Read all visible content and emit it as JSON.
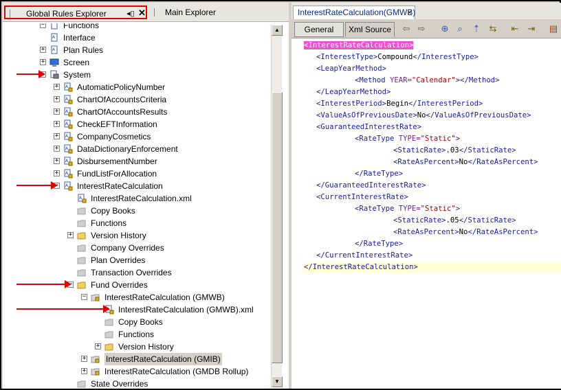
{
  "left_panel": {
    "active_tab": "Global Rules Explorer",
    "inactive_tab": "Main Explorer",
    "tree": [
      {
        "label": "Functions",
        "indent": 0,
        "kind": "folder-doc",
        "expander": "minus"
      },
      {
        "label": "Interface",
        "indent": 0,
        "kind": "doc",
        "expander": "none"
      },
      {
        "label": "Plan Rules",
        "indent": 0,
        "kind": "doc",
        "expander": "plus"
      },
      {
        "label": "Screen",
        "indent": 0,
        "kind": "screen",
        "expander": "plus"
      },
      {
        "label": "System",
        "indent": 0,
        "kind": "system",
        "expander": "minus"
      },
      {
        "label": "AutomaticPolicyNumber",
        "indent": 1,
        "kind": "lockdoc",
        "expander": "plus"
      },
      {
        "label": "ChartOfAccountsCriteria",
        "indent": 1,
        "kind": "lockdoc",
        "expander": "plus"
      },
      {
        "label": "ChartOfAccountsResults",
        "indent": 1,
        "kind": "lockdoc",
        "expander": "plus"
      },
      {
        "label": "CheckEFTInformation",
        "indent": 1,
        "kind": "lockdoc",
        "expander": "plus"
      },
      {
        "label": "CompanyCosmetics",
        "indent": 1,
        "kind": "lockdoc",
        "expander": "plus"
      },
      {
        "label": "DataDictionaryEnforcement",
        "indent": 1,
        "kind": "lockdoc",
        "expander": "plus"
      },
      {
        "label": "DisbursementNumber",
        "indent": 1,
        "kind": "lockdoc",
        "expander": "plus"
      },
      {
        "label": "FundListForAllocation",
        "indent": 1,
        "kind": "lockdoc",
        "expander": "plus"
      },
      {
        "label": "InterestRateCalculation",
        "indent": 1,
        "kind": "lockdoc",
        "expander": "minus"
      },
      {
        "label": "InterestRateCalculation.xml",
        "indent": 2,
        "kind": "lockdoc",
        "expander": "none"
      },
      {
        "label": "Copy Books",
        "indent": 2,
        "kind": "greyfolder",
        "expander": "none"
      },
      {
        "label": "Functions",
        "indent": 2,
        "kind": "greyfolder",
        "expander": "none"
      },
      {
        "label": "Version History",
        "indent": 2,
        "kind": "folder",
        "expander": "plus"
      },
      {
        "label": "Company Overrides",
        "indent": 2,
        "kind": "greyfolder",
        "expander": "none"
      },
      {
        "label": "Plan Overrides",
        "indent": 2,
        "kind": "greyfolder",
        "expander": "none"
      },
      {
        "label": "Transaction Overrides",
        "indent": 2,
        "kind": "greyfolder",
        "expander": "none"
      },
      {
        "label": "Fund Overrides",
        "indent": 2,
        "kind": "folder",
        "expander": "minus"
      },
      {
        "label": "InterestRateCalculation (GMWB)",
        "indent": 3,
        "kind": "lockfolder",
        "expander": "minus"
      },
      {
        "label": "InterestRateCalculation (GMWB).xml",
        "indent": 4,
        "kind": "lockdoc",
        "expander": "none"
      },
      {
        "label": "Copy Books",
        "indent": 4,
        "kind": "greyfolder",
        "expander": "none"
      },
      {
        "label": "Functions",
        "indent": 4,
        "kind": "greyfolder",
        "expander": "none"
      },
      {
        "label": "Version History",
        "indent": 4,
        "kind": "folder",
        "expander": "plus"
      },
      {
        "label": "InterestRateCalculation (GMIB)",
        "indent": 3,
        "kind": "lockfolder",
        "expander": "plus",
        "selected": true
      },
      {
        "label": "InterestRateCalculation (GMDB Rollup)",
        "indent": 3,
        "kind": "lockfolder",
        "expander": "plus"
      },
      {
        "label": "State Overrides",
        "indent": 2,
        "kind": "greyfolder",
        "expander": "none"
      }
    ]
  },
  "right_panel": {
    "document_tab": "InterestRateCalculation(GMWB)",
    "close_glyph": "×",
    "sub_tabs": [
      "General",
      "Xml Source"
    ],
    "active_sub_tab": "Xml Source",
    "xml_lines": [
      {
        "indent": 0,
        "parts": [
          {
            "t": "tag",
            "v": "<InterestRateCalculation>"
          }
        ],
        "highlight": true
      },
      {
        "indent": 1,
        "parts": [
          {
            "t": "tag",
            "v": "<InterestType>"
          },
          {
            "t": "txt",
            "v": "Compound"
          },
          {
            "t": "tag",
            "v": "</InterestType>"
          }
        ]
      },
      {
        "indent": 1,
        "parts": [
          {
            "t": "tag",
            "v": "<LeapYearMethod>"
          }
        ]
      },
      {
        "indent": 2,
        "parts": [
          {
            "t": "tag",
            "v": "<Method "
          },
          {
            "t": "attr",
            "v": "YEAR="
          },
          {
            "t": "val",
            "v": "\"Calendar\""
          },
          {
            "t": "tag",
            "v": "></Method>"
          }
        ]
      },
      {
        "indent": 1,
        "parts": [
          {
            "t": "tag",
            "v": "</LeapYearMethod>"
          }
        ]
      },
      {
        "indent": 1,
        "parts": [
          {
            "t": "tag",
            "v": "<InterestPeriod>"
          },
          {
            "t": "txt",
            "v": "Begin"
          },
          {
            "t": "tag",
            "v": "</InterestPeriod>"
          }
        ]
      },
      {
        "indent": 1,
        "parts": [
          {
            "t": "tag",
            "v": "<ValueAsOfPreviousDate>"
          },
          {
            "t": "txt",
            "v": "No"
          },
          {
            "t": "tag",
            "v": "</ValueAsOfPreviousDate>"
          }
        ]
      },
      {
        "indent": 1,
        "parts": [
          {
            "t": "tag",
            "v": "<GuaranteedInterestRate>"
          }
        ]
      },
      {
        "indent": 2,
        "parts": [
          {
            "t": "tag",
            "v": "<RateType "
          },
          {
            "t": "attr",
            "v": "TYPE="
          },
          {
            "t": "val",
            "v": "\"Static\""
          },
          {
            "t": "tag",
            "v": ">"
          }
        ]
      },
      {
        "indent": 3,
        "parts": [
          {
            "t": "tag",
            "v": "<StaticRate>"
          },
          {
            "t": "txt",
            "v": ".03"
          },
          {
            "t": "tag",
            "v": "</StaticRate>"
          }
        ]
      },
      {
        "indent": 3,
        "parts": [
          {
            "t": "tag",
            "v": "<RateAsPercent>"
          },
          {
            "t": "txt",
            "v": "No"
          },
          {
            "t": "tag",
            "v": "</RateAsPercent>"
          }
        ]
      },
      {
        "indent": 2,
        "parts": [
          {
            "t": "tag",
            "v": "</RateType>"
          }
        ]
      },
      {
        "indent": 1,
        "parts": [
          {
            "t": "tag",
            "v": "</GuaranteedInterestRate>"
          }
        ]
      },
      {
        "indent": 1,
        "parts": [
          {
            "t": "tag",
            "v": "<CurrentInterestRate>"
          }
        ]
      },
      {
        "indent": 2,
        "parts": [
          {
            "t": "tag",
            "v": "<RateType "
          },
          {
            "t": "attr",
            "v": "TYPE="
          },
          {
            "t": "val",
            "v": "\"Static\""
          },
          {
            "t": "tag",
            "v": ">"
          }
        ]
      },
      {
        "indent": 3,
        "parts": [
          {
            "t": "tag",
            "v": "<StaticRate>"
          },
          {
            "t": "txt",
            "v": ".05"
          },
          {
            "t": "tag",
            "v": "</StaticRate>"
          }
        ]
      },
      {
        "indent": 3,
        "parts": [
          {
            "t": "tag",
            "v": "<RateAsPercent>"
          },
          {
            "t": "txt",
            "v": "No"
          },
          {
            "t": "tag",
            "v": "</RateAsPercent>"
          }
        ]
      },
      {
        "indent": 2,
        "parts": [
          {
            "t": "tag",
            "v": "</RateType>"
          }
        ]
      },
      {
        "indent": 1,
        "parts": [
          {
            "t": "tag",
            "v": "</CurrentInterestRate>"
          }
        ]
      },
      {
        "indent": 0,
        "parts": [
          {
            "t": "tag",
            "v": "</InterestRateCalculation>"
          }
        ],
        "current": true
      }
    ]
  },
  "colors": {
    "annotation_red": "#e00000",
    "xml_tag": "#1a1aa6",
    "xml_attr": "#7a1fa0",
    "xml_value": "#b00000",
    "highlight": "#f050d0"
  }
}
